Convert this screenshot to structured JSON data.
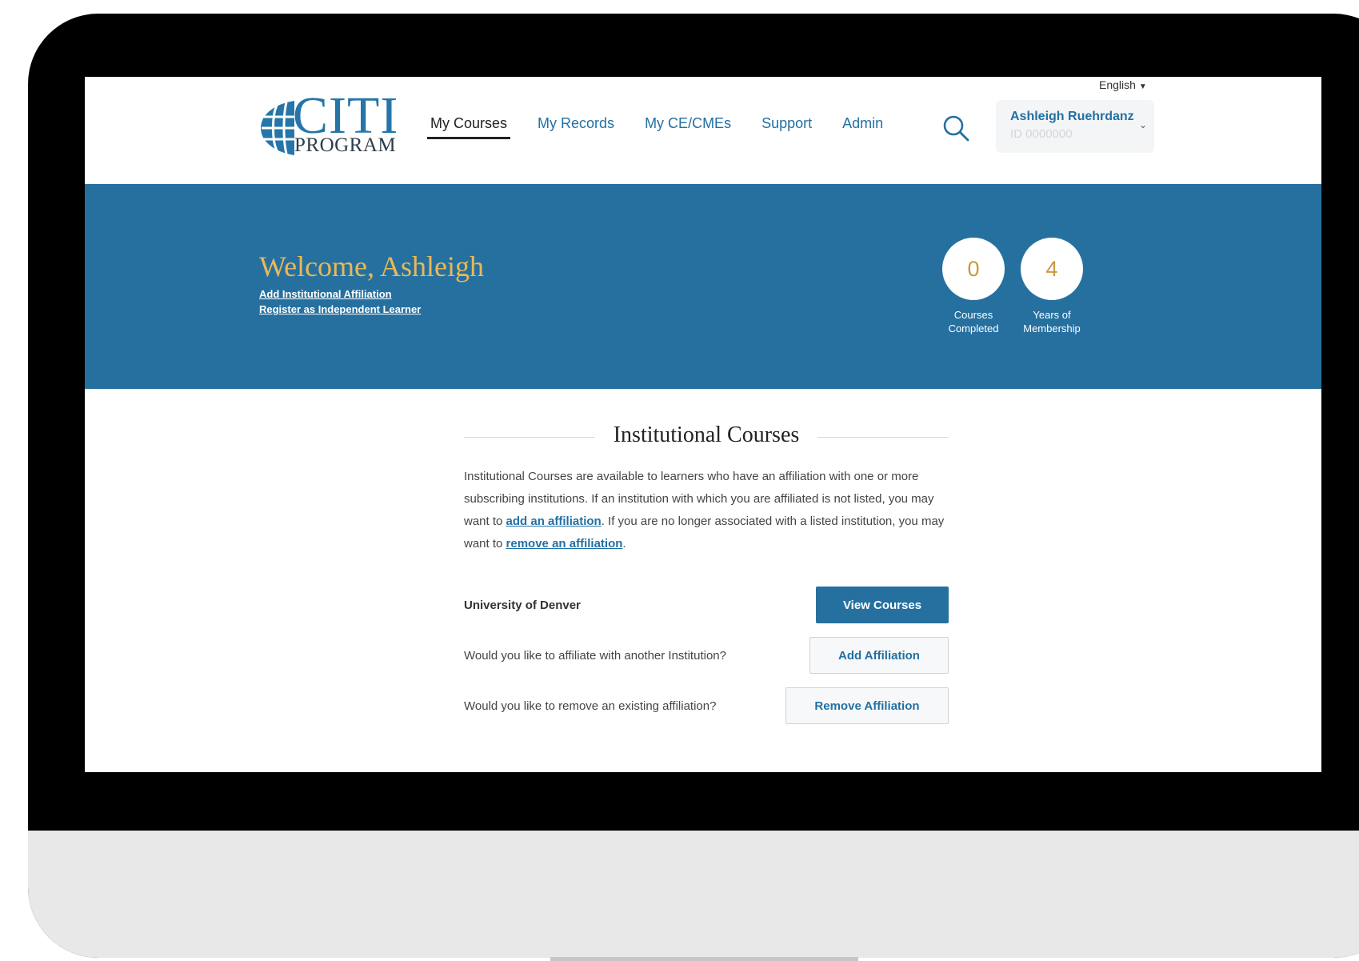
{
  "header": {
    "logo": {
      "top": "CITI",
      "bottom": "PROGRAM"
    },
    "nav": [
      {
        "label": "My Courses",
        "active": true
      },
      {
        "label": "My Records",
        "active": false
      },
      {
        "label": "My CE/CMEs",
        "active": false
      },
      {
        "label": "Support",
        "active": false
      },
      {
        "label": "Admin",
        "active": false
      }
    ],
    "search_icon": "search-icon",
    "language": "English",
    "user": {
      "name": "Ashleigh Ruehrdanz",
      "id": "ID 0000000"
    }
  },
  "banner": {
    "welcome": "Welcome, Ashleigh",
    "links": [
      "Add Institutional Affiliation",
      "Register as Independent Learner"
    ],
    "stats": [
      {
        "value": "0",
        "label_line1": "Courses",
        "label_line2": "Completed"
      },
      {
        "value": "4",
        "label_line1": "Years of",
        "label_line2": "Membership"
      }
    ]
  },
  "institutional": {
    "title": "Institutional Courses",
    "desc_part1": "Institutional Courses are available to learners who have an affiliation with one or more subscribing institutions. If an institution with which you are affiliated is not listed, you may want to ",
    "desc_link1": "add an affiliation",
    "desc_part2": ". If you are no longer associated with a listed institution, you may want to ",
    "desc_link2": "remove an affiliation",
    "desc_part3": ".",
    "rows": [
      {
        "label": "University of Denver",
        "button": "View Courses"
      },
      {
        "label": "Would you like to affiliate with another Institution?",
        "button": "Add Affiliation"
      },
      {
        "label": "Would you like to remove an existing affiliation?",
        "button": "Remove Affiliation"
      }
    ]
  },
  "colors": {
    "brand_blue": "#2670a0",
    "welcome_gold": "#e8b956",
    "link_blue": "#2270a3"
  }
}
